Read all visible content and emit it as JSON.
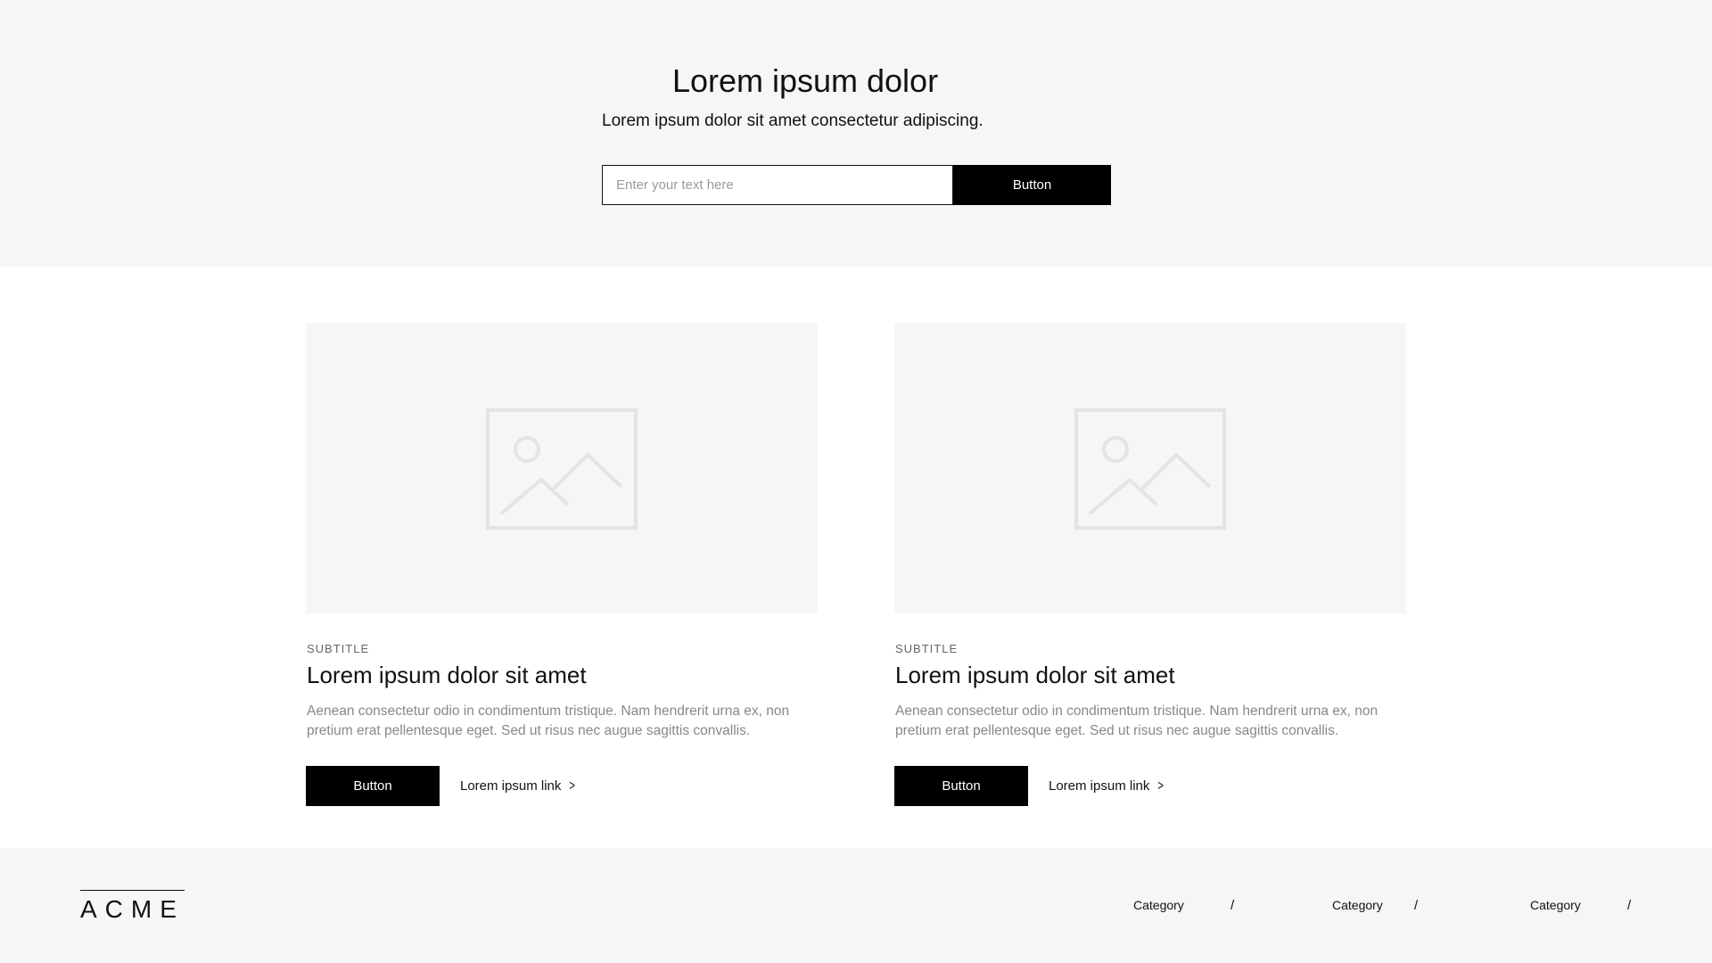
{
  "hero": {
    "title": "Lorem ipsum dolor",
    "subtitle": "Lorem ipsum dolor sit amet consectetur adipiscing.",
    "input_placeholder": "Enter your text here",
    "button_label": "Button"
  },
  "cards": [
    {
      "image_icon": "image-placeholder-icon",
      "subtitle": "SUBTITLE",
      "title": "Lorem ipsum dolor sit amet",
      "text": "Aenean consectetur odio in condimentum tristique. Nam hendrerit urna ex, non pretium erat pellentesque eget. Sed ut risus nec augue sagittis convallis.",
      "button_label": "Button",
      "link_label": "Lorem ipsum link",
      "link_icon": "chevron-right-icon"
    },
    {
      "image_icon": "image-placeholder-icon",
      "subtitle": "SUBTITLE",
      "title": "Lorem ipsum dolor sit amet",
      "text": "Aenean consectetur odio in condimentum tristique. Nam hendrerit urna ex, non pretium erat pellentesque eget. Sed ut risus nec augue sagittis convallis.",
      "button_label": "Button",
      "link_label": "Lorem ipsum link",
      "link_icon": "chevron-right-icon"
    }
  ],
  "footer": {
    "logo_text": "ACME",
    "nav": [
      {
        "label": "Category",
        "separator": "/"
      },
      {
        "label": "Category",
        "separator": "/"
      },
      {
        "label": "Category",
        "separator": "/"
      }
    ]
  },
  "colors": {
    "background_light": "#f5f6f7",
    "button_bg": "#000000",
    "button_text": "#ffffff",
    "body_text": "#888888"
  }
}
